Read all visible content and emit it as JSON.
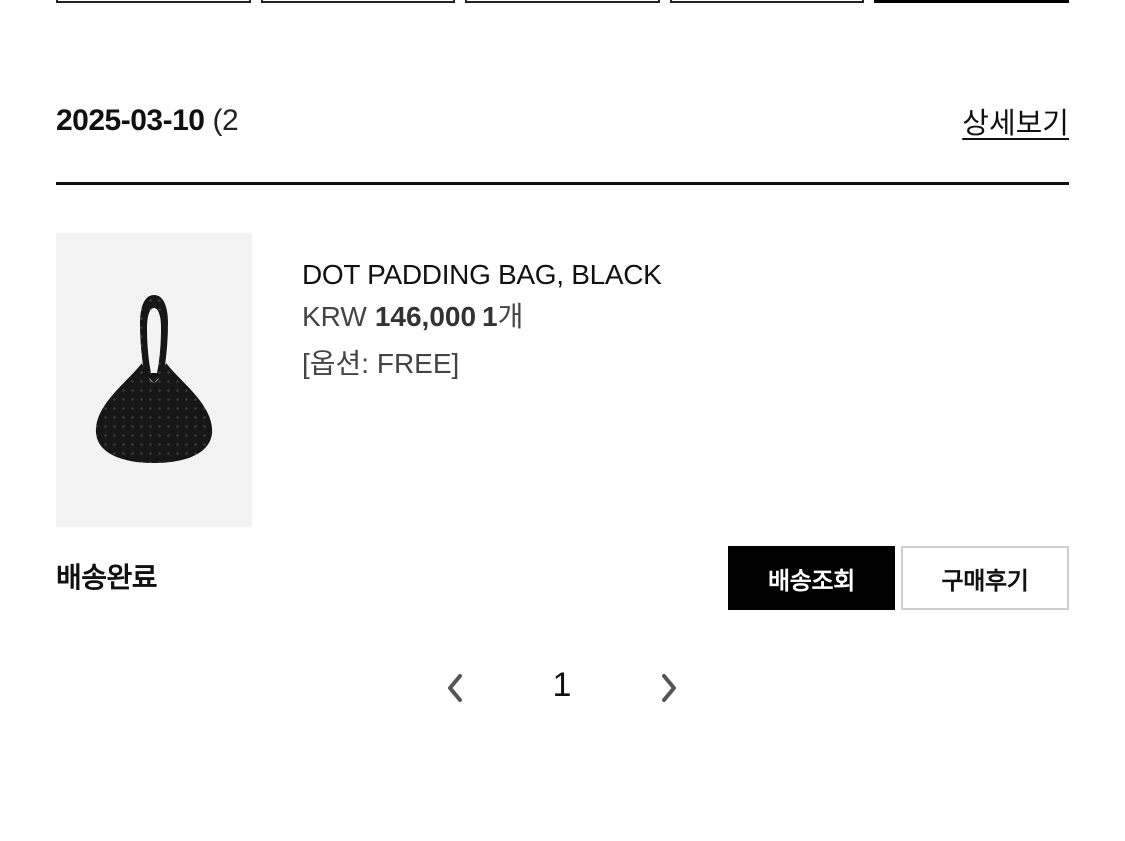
{
  "top_tabs": [
    {
      "label": ""
    },
    {
      "label": ""
    },
    {
      "label": ""
    },
    {
      "label": ""
    },
    {
      "label": "",
      "active": true
    }
  ],
  "order": {
    "date": "2025-03-10",
    "date_suffix": "(2",
    "detail_link": "상세보기"
  },
  "product": {
    "image_alt": "black hobo bag icon",
    "name": "DOT PADDING BAG, BLACK",
    "currency": "KRW",
    "price": "146,000",
    "quantity": "1",
    "quantity_unit": "개",
    "option": "[옵션: FREE]"
  },
  "status": {
    "label": "배송완료"
  },
  "actions": {
    "track_label": "배송조회",
    "review_label": "구매후기"
  },
  "pagination": {
    "prev_icon": "chevron-left-icon",
    "current_page": "1",
    "next_icon": "chevron-right-icon"
  },
  "colors": {
    "primary_button_bg": "#000000",
    "primary_button_text": "#ffffff",
    "secondary_button_border": "#cfcfcf",
    "product_bg": "#f3f3f3"
  }
}
